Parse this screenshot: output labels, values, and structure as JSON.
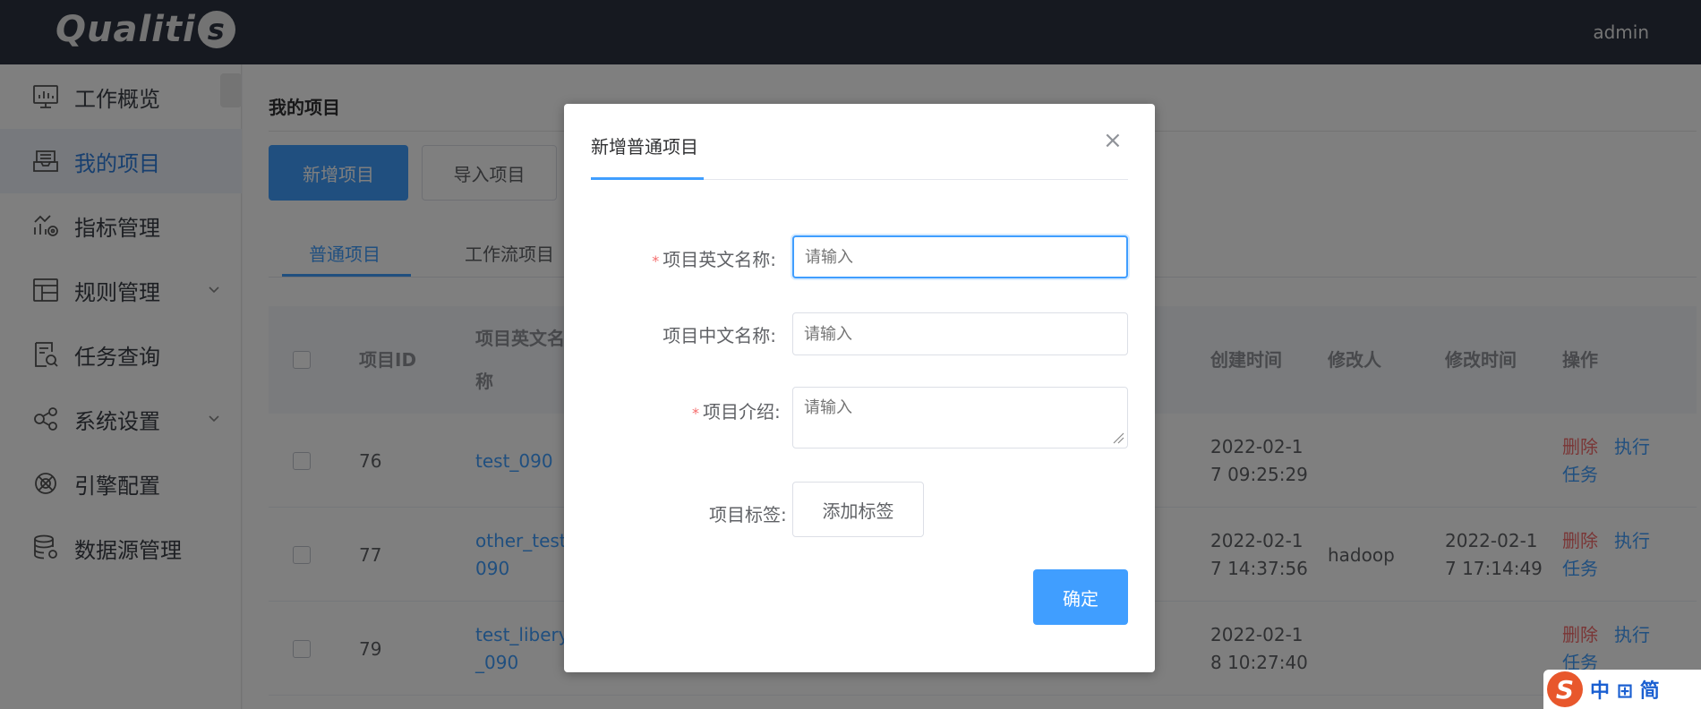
{
  "header": {
    "logo_text": "Qualiti",
    "logo_s": "s",
    "user": "admin"
  },
  "sidebar": {
    "items": [
      {
        "label": "工作概览",
        "icon": "dashboard-icon",
        "active": false,
        "has_caret": false
      },
      {
        "label": "我的项目",
        "icon": "inbox-icon",
        "active": true,
        "has_caret": false
      },
      {
        "label": "指标管理",
        "icon": "metric-icon",
        "active": false,
        "has_caret": false
      },
      {
        "label": "规则管理",
        "icon": "layout-icon",
        "active": false,
        "has_caret": true
      },
      {
        "label": "任务查询",
        "icon": "document-search-icon",
        "active": false,
        "has_caret": false
      },
      {
        "label": "系统设置",
        "icon": "share-icon",
        "active": false,
        "has_caret": true
      },
      {
        "label": "引擎配置",
        "icon": "engine-icon",
        "active": false,
        "has_caret": false
      },
      {
        "label": "数据源管理",
        "icon": "database-icon",
        "active": false,
        "has_caret": false
      }
    ]
  },
  "main": {
    "title": "我的项目",
    "add_button": "新增项目",
    "import_button": "导入项目",
    "tabs": [
      "普通项目",
      "工作流项目"
    ],
    "table": {
      "headers": {
        "id": "项目ID",
        "name_line1": "项目英文名",
        "name_line2": "称",
        "created": "创建时间",
        "modifier": "修改人",
        "modified": "修改时间",
        "actions": "操作"
      },
      "rows": [
        {
          "id": "76",
          "name1": "test_090",
          "name2": "",
          "created1": "2022-02-1",
          "created2": "7 09:25:29",
          "modifier": "",
          "modified1": "",
          "modified2": "",
          "delete": "删除",
          "exec1": "执行",
          "exec2": "任务"
        },
        {
          "id": "77",
          "name1": "other_test_",
          "name2": "090",
          "created1": "2022-02-1",
          "created2": "7 14:37:56",
          "modifier": "hadoop",
          "modified1": "2022-02-1",
          "modified2": "7 17:14:49",
          "delete": "删除",
          "exec1": "执行",
          "exec2": "任务"
        },
        {
          "id": "79",
          "name1": "test_libery",
          "name2": "_090",
          "created1": "2022-02-1",
          "created2": "8 10:27:40",
          "modifier": "",
          "modified1": "",
          "modified2": "",
          "delete": "删除",
          "exec1": "执行",
          "exec2": "任务"
        }
      ]
    }
  },
  "dialog": {
    "title": "新增普通项目",
    "close": "×",
    "fields": {
      "en_name": {
        "label": "项目英文名称:",
        "required": true,
        "placeholder": "请输入",
        "value": ""
      },
      "cn_name": {
        "label": "项目中文名称:",
        "required": false,
        "placeholder": "请输入",
        "value": ""
      },
      "intro": {
        "label": "项目介绍:",
        "required": true,
        "placeholder": "请输入",
        "value": ""
      },
      "tags": {
        "label": "项目标签:",
        "button": "添加标签"
      }
    },
    "confirm": "确定",
    "required_mark": "*"
  },
  "ime": {
    "logo": "S",
    "text": "中 ⊞ 简"
  },
  "colors": {
    "primary": "#409eff",
    "header_bg": "#2d3340",
    "danger": "#f56c6c"
  }
}
